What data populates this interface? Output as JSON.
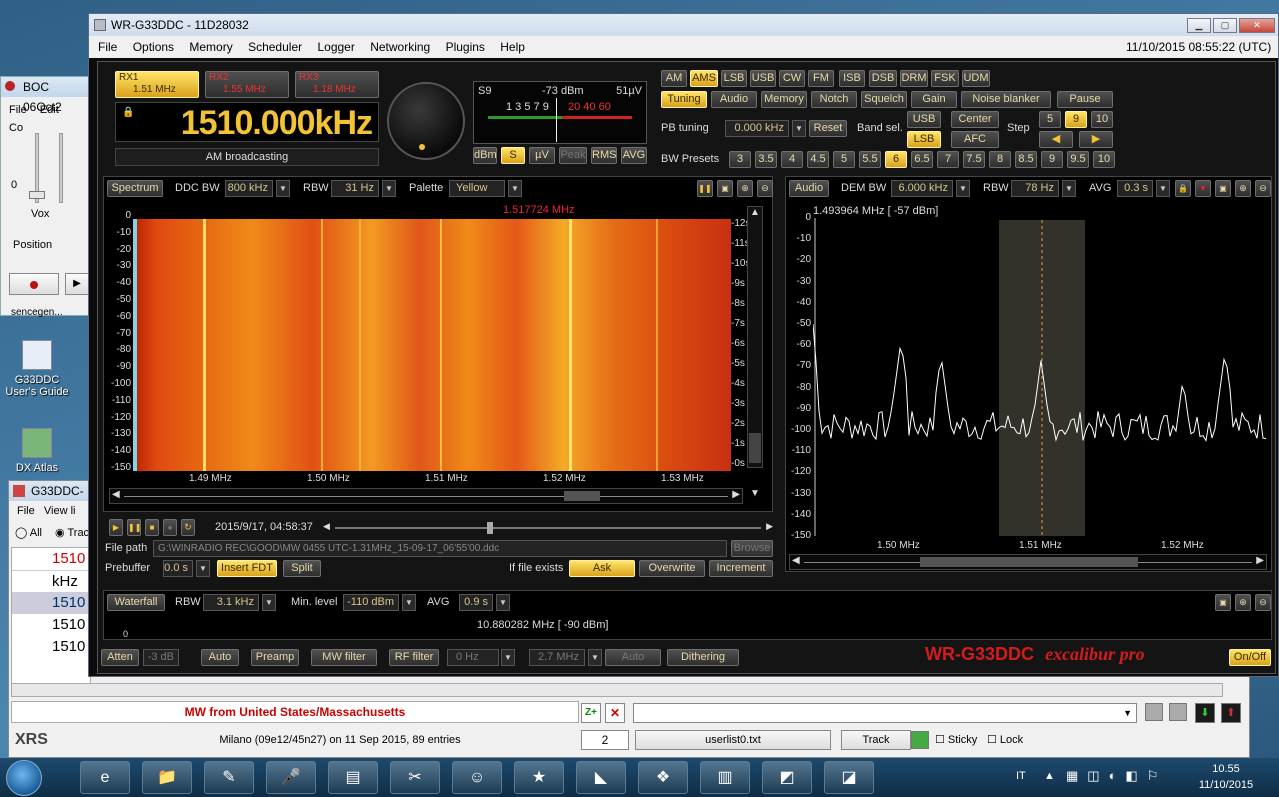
{
  "boc_window": {
    "title": "BOC 06Oct2",
    "menu": [
      "File",
      "Edit",
      "Co"
    ],
    "vox_label": "Vox",
    "vox_value": "0",
    "position_label": "Position",
    "truncated_text": "sencegen..."
  },
  "desktop_icons": [
    {
      "name": "g33ddc-guide",
      "label": "G33DDC User's Guide",
      "icon": "shortcut-doc-icon"
    },
    {
      "name": "dx-atlas",
      "label": "DX Atlas",
      "icon": "dx-atlas-icon"
    }
  ],
  "list_window": {
    "title": "G33DDC-",
    "menu": [
      "File",
      "View li"
    ],
    "radio_all": "All",
    "radio_track": "Trac",
    "rows": [
      "1510",
      "kHz",
      "1510",
      "1510",
      "1510"
    ],
    "status_text": "MW from United States/Massachusetts",
    "location_text": "Milano (09e12/45n27) on 11 Sep 2015, 89 entries",
    "brand": "XRS",
    "count": "2",
    "file": "userlist0.txt",
    "track_button": "Track",
    "sticky_label": "Sticky",
    "lock_label": "Lock"
  },
  "app": {
    "title": "WR-G33DDC - 11D28032",
    "datetime": "11/10/2015 08:55:22 (UTC)",
    "menu": [
      "File",
      "Options",
      "Memory",
      "Scheduler",
      "Logger",
      "Networking",
      "Plugins",
      "Help"
    ],
    "rx_tabs": [
      {
        "label": "RX1",
        "freq": "1.51 MHz"
      },
      {
        "label": "RX2",
        "freq": "1.55 MHz"
      },
      {
        "label": "RX3",
        "freq": "1.18 MHz"
      }
    ],
    "frequency": "1510.000kHz",
    "band_name": "AM broadcasting",
    "smeter": {
      "scale": "S9",
      "level": "-73 dBm",
      "uv": "51µV",
      "ticks": "1 3 5 7 9",
      "db_ticks": "20 40 60"
    },
    "meter_modes": [
      "dBm",
      "S",
      "µV",
      "Peak",
      "RMS",
      "AVG"
    ],
    "modes": [
      "AM",
      "AMS",
      "LSB",
      "USB",
      "CW",
      "FM",
      "ISB",
      "DSB",
      "DRM",
      "FSK",
      "UDM"
    ],
    "active_mode": "AMS",
    "functions": [
      "Tuning",
      "Audio",
      "Memory",
      "Notch",
      "Squelch",
      "Gain",
      "Noise blanker",
      "Pause"
    ],
    "pb_tuning_label": "PB tuning",
    "pb_tuning_value": "0.000 kHz",
    "reset_label": "Reset",
    "band_sel_label": "Band sel.",
    "band_usb": "USB",
    "band_lsb": "LSB",
    "center_label": "Center",
    "afc_label": "AFC",
    "step_label": "Step",
    "steps": [
      "5",
      "9",
      "10"
    ],
    "bw_presets_label": "BW Presets",
    "bw_presets": [
      "3",
      "3.5",
      "4",
      "4.5",
      "5",
      "5.5",
      "6",
      "6.5",
      "7",
      "7.5",
      "8",
      "8.5",
      "9",
      "9.5",
      "10"
    ],
    "active_bw": "6",
    "spectrum": {
      "button": "Spectrum",
      "ddc_bw_label": "DDC BW",
      "ddc_bw": "800 kHz",
      "rbw_label": "RBW",
      "rbw": "31 Hz",
      "palette_label": "Palette",
      "palette": "Yellow",
      "marker": "1.517724 MHz",
      "db_ticks": [
        "0",
        "-10",
        "-20",
        "-30",
        "-40",
        "-50",
        "-60",
        "-70",
        "-80",
        "-90",
        "-100",
        "-110",
        "-120",
        "-130",
        "-140",
        "-150"
      ],
      "time_ticks": [
        "-12s",
        "-11s",
        "-10s",
        "-9s",
        "-8s",
        "-7s",
        "-6s",
        "-5s",
        "-4s",
        "-3s",
        "-2s",
        "-1s",
        "-0s"
      ],
      "freq_ticks": [
        "1.49 MHz",
        "1.50 MHz",
        "1.51 MHz",
        "1.52 MHz",
        "1.53 MHz"
      ]
    },
    "audio": {
      "button": "Audio",
      "dem_bw_label": "DEM BW",
      "dem_bw": "6.000 kHz",
      "rbw_label": "RBW",
      "rbw": "78 Hz",
      "avg_label": "AVG",
      "avg": "0.3 s",
      "marker": "1.493964 MHz [   -57 dBm]",
      "db_ticks": [
        "0",
        "-10",
        "-20",
        "-30",
        "-40",
        "-50",
        "-60",
        "-70",
        "-80",
        "-90",
        "-100",
        "-110",
        "-120",
        "-130",
        "-140",
        "-150"
      ],
      "freq_ticks": [
        "1.50 MHz",
        "1.51 MHz",
        "1.52 MHz"
      ]
    },
    "recorder": {
      "timestamp": "2015/9/17, 04:58:37",
      "file_path_label": "File path",
      "file_path": "G:\\WINRADIO REC\\GOOD\\MW 0455 UTC-1.31MHz_15-09-17_06'55'00.ddc",
      "browse": "Browse",
      "prebuffer_label": "Prebuffer",
      "prebuffer": "0.0 s",
      "insert_fdt": "Insert FDT",
      "split": "Split",
      "if_exists_label": "If file exists",
      "ask": "Ask",
      "overwrite": "Overwrite",
      "increment": "Increment"
    },
    "waterfall": {
      "button": "Waterfall",
      "rbw_label": "RBW",
      "rbw": "3.1 kHz",
      "min_level_label": "Min. level",
      "min_level": "-110 dBm",
      "avg_label": "AVG",
      "avg": "0.9 s",
      "marker": "10.880282 MHz [   -90 dBm]",
      "zero": "0"
    },
    "bottom_bar": {
      "atten": "Atten",
      "atten_value": "-3 dB",
      "auto": "Auto",
      "preamp": "Preamp",
      "mw_filter": "MW filter",
      "rf_filter": "RF filter",
      "rf_low": "0 Hz",
      "rf_high": "2.7 MHz",
      "rf_auto": "Auto",
      "dithering": "Dithering",
      "brand_model": "WR-G33DDC",
      "brand_name": "excalibur pro",
      "onoff": "On/Off"
    }
  },
  "taskbar": {
    "lang": "IT",
    "time": "10.55",
    "date": "11/10/2015",
    "apps": [
      "ie-icon",
      "explorer-icon",
      "notepad-icon",
      "microphone-icon",
      "radio-card-icon",
      "scissors-icon",
      "person-icon",
      "star-icon",
      "vs-icon",
      "dropbox-icon",
      "chart-icon",
      "excalibur-icon",
      "dx-icon"
    ]
  }
}
